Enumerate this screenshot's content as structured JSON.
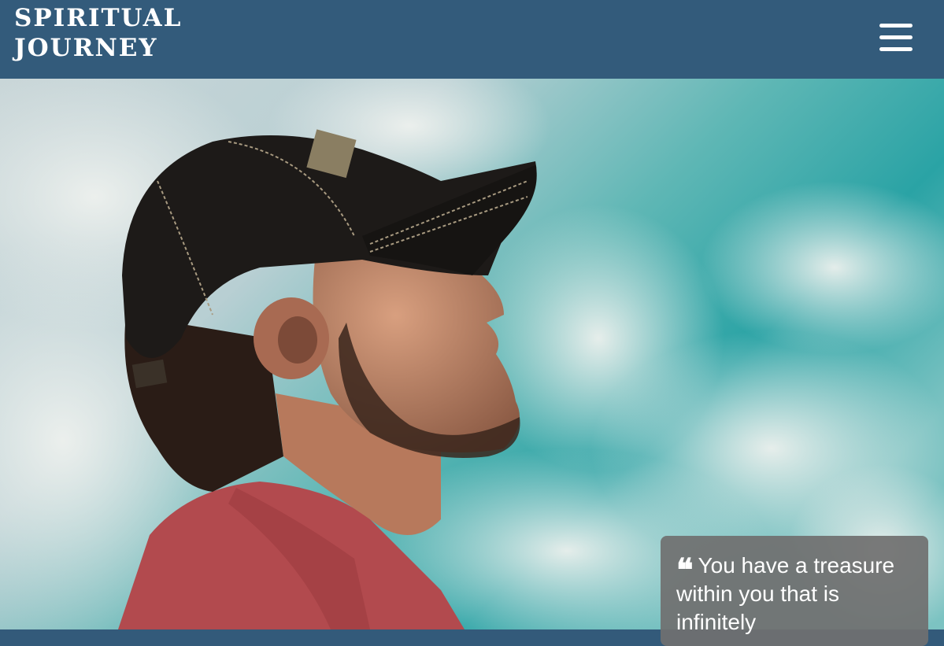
{
  "header": {
    "brand_line1": "SPIRITUAL",
    "brand_line2": "JOURNEY",
    "menu_icon": "hamburger-menu-icon",
    "background": "#335b7b"
  },
  "hero": {
    "image": "man-in-cap-facing-sky-photo"
  },
  "quote": {
    "icon": "quote-icon",
    "text": "You have a treasure within you that is infinitely"
  }
}
